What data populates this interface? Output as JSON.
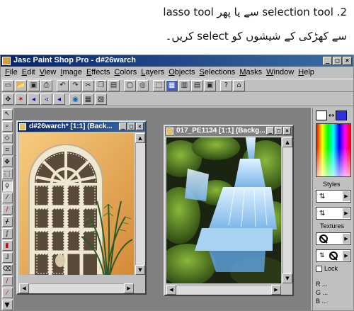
{
  "caption": {
    "line1_rtl": "2. selection tool سے یا پھر lasso tool",
    "line2_rtl": "سے کھڑکی کے شیشوں کو select کریں۔"
  },
  "window": {
    "title": "Jasc Paint Shop Pro - d#26warch",
    "minimize": "_",
    "maximize": "□",
    "close": "×"
  },
  "menu": [
    "File",
    "Edit",
    "View",
    "Image",
    "Effects",
    "Colors",
    "Layers",
    "Objects",
    "Selections",
    "Masks",
    "Window",
    "Help"
  ],
  "toolbar1": [
    "new-icon",
    "open-icon",
    "save-icon",
    "print-icon",
    "undo-icon",
    "redo-icon",
    "cut-icon",
    "copy-icon",
    "paste-icon",
    "view-icon",
    "browse-icon",
    "selection-tool-icon",
    "color-palette-icon",
    "histogram-icon",
    "layers-palette-icon",
    "overview-icon",
    "help-icon",
    "lock-icon"
  ],
  "toolbar2": [
    "move-icon",
    "star-icon",
    "back-icon",
    "forward-icon",
    "back2-icon",
    "web-icon",
    "image-icon",
    "image2-icon"
  ],
  "tools": [
    "arrow-tool-icon",
    "zoom-tool-icon",
    "deform-tool-icon",
    "crop-tool-icon",
    "mover-tool-icon",
    "selection-tool-icon",
    "lasso-tool-icon",
    "dropper-tool-icon",
    "paintbrush-tool-icon",
    "clone-tool-icon",
    "color-replacer-icon",
    "retouch-tool-icon",
    "scratch-remover-icon",
    "eraser-tool-icon",
    "picture-tube-icon",
    "airbrush-icon",
    "flood-fill-icon"
  ],
  "doc1": {
    "title": "d#26warch* [1:1] (Back...",
    "active": true
  },
  "doc2": {
    "title": "017_PE1134 [1:1] (Backg...",
    "active": false
  },
  "panel": {
    "styles_label": "Styles",
    "textures_label": "Textures",
    "lock_label": "Lock",
    "r_label": "R ...",
    "g_label": "G ...",
    "b_label": "B ...",
    "fg_color": "#ffffff",
    "bg_color": "#3030e0"
  }
}
